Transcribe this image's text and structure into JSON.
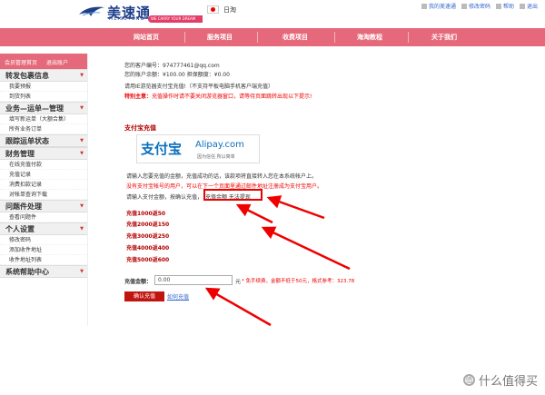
{
  "brand": {
    "cn": "美速通",
    "en": "MEISUTONG",
    "slogan": "WE CARRY YOUR DREAM"
  },
  "region": "日淘",
  "toplinks": [
    {
      "label": "我的美速通",
      "icon": "home-icon"
    },
    {
      "label": "修改密码",
      "icon": "key-icon"
    },
    {
      "label": "帮助",
      "icon": "help-icon"
    },
    {
      "label": "退出",
      "icon": "logout-icon"
    }
  ],
  "nav": [
    "网站首页",
    "服务项目",
    "收费项目",
    "海淘教程",
    "关于我们"
  ],
  "sidebar": {
    "top_links": [
      "会员管理首页",
      "退出账户"
    ],
    "sections": [
      {
        "title": "转发包裹信息",
        "items": [
          "我要预报",
          "到货列表"
        ]
      },
      {
        "title": "业务—运单—管理",
        "items": [
          "填写新运单（大额合集）",
          "所有业务订单"
        ]
      },
      {
        "title": "跟踪运单状态",
        "items": []
      },
      {
        "title": "财务管理",
        "items": [
          "在线充值付款",
          "充值记录",
          "消费扣款记录",
          "对帐单查询下载"
        ]
      },
      {
        "title": "问题件处理",
        "items": [
          "查看问题件"
        ]
      },
      {
        "title": "个人设置",
        "items": [
          "修改密码",
          "添加收件地址",
          "收件地址列表"
        ]
      },
      {
        "title": "系统帮助中心",
        "items": []
      }
    ]
  },
  "account": {
    "number_label": "您的客户编号：",
    "number": "974777461@qq.com",
    "balance_label": "您的账户余额：",
    "balance": "¥100.00",
    "credit_label": "担保额度：",
    "credit": "¥0.00"
  },
  "notice1": "请用IE游览器支付宝充值!（不支持平板电脑手机客户端充值）",
  "notice2_label": "特别主意：",
  "notice2": "充值操作时请不要关闭游览器窗口，请等待页面跳转出现以下提示!",
  "alipay": {
    "section_title": "支付宝充值",
    "logo_cn": "支付宝",
    "logo_domain": "Alipay.com",
    "trust": "因为信任  所以简单"
  },
  "intro": "请输入您要充值的金额，充值成功的话，该款项将直接转入您在本系统帐户上。",
  "no_account_notice": "没有支付宝帐号的用户，可以在下一个页面里通过邮件地址注册成为支付宝用户。",
  "enter_amount_prefix": "请输入支付金额，按确认充值，",
  "enter_amount_boxed": "充值金额 无法提现",
  "bonuses": [
    "充值1000返50",
    "充值2000返150",
    "充值3000返250",
    "充值4000返400",
    "充值5000返600"
  ],
  "amount_label": "充值金额：",
  "amount_value": "0.00",
  "amount_unit": "元",
  "fee_note": "* 免手续费，金额不低于50元，格式参考：323.78",
  "recharge_button": "确认充值",
  "how_link": "如何充值",
  "watermark": "什么值得买",
  "colors": {
    "nav": "#e5697a",
    "brand": "#1e3f8a",
    "button": "#c0140f",
    "highlight": "#e00000"
  }
}
